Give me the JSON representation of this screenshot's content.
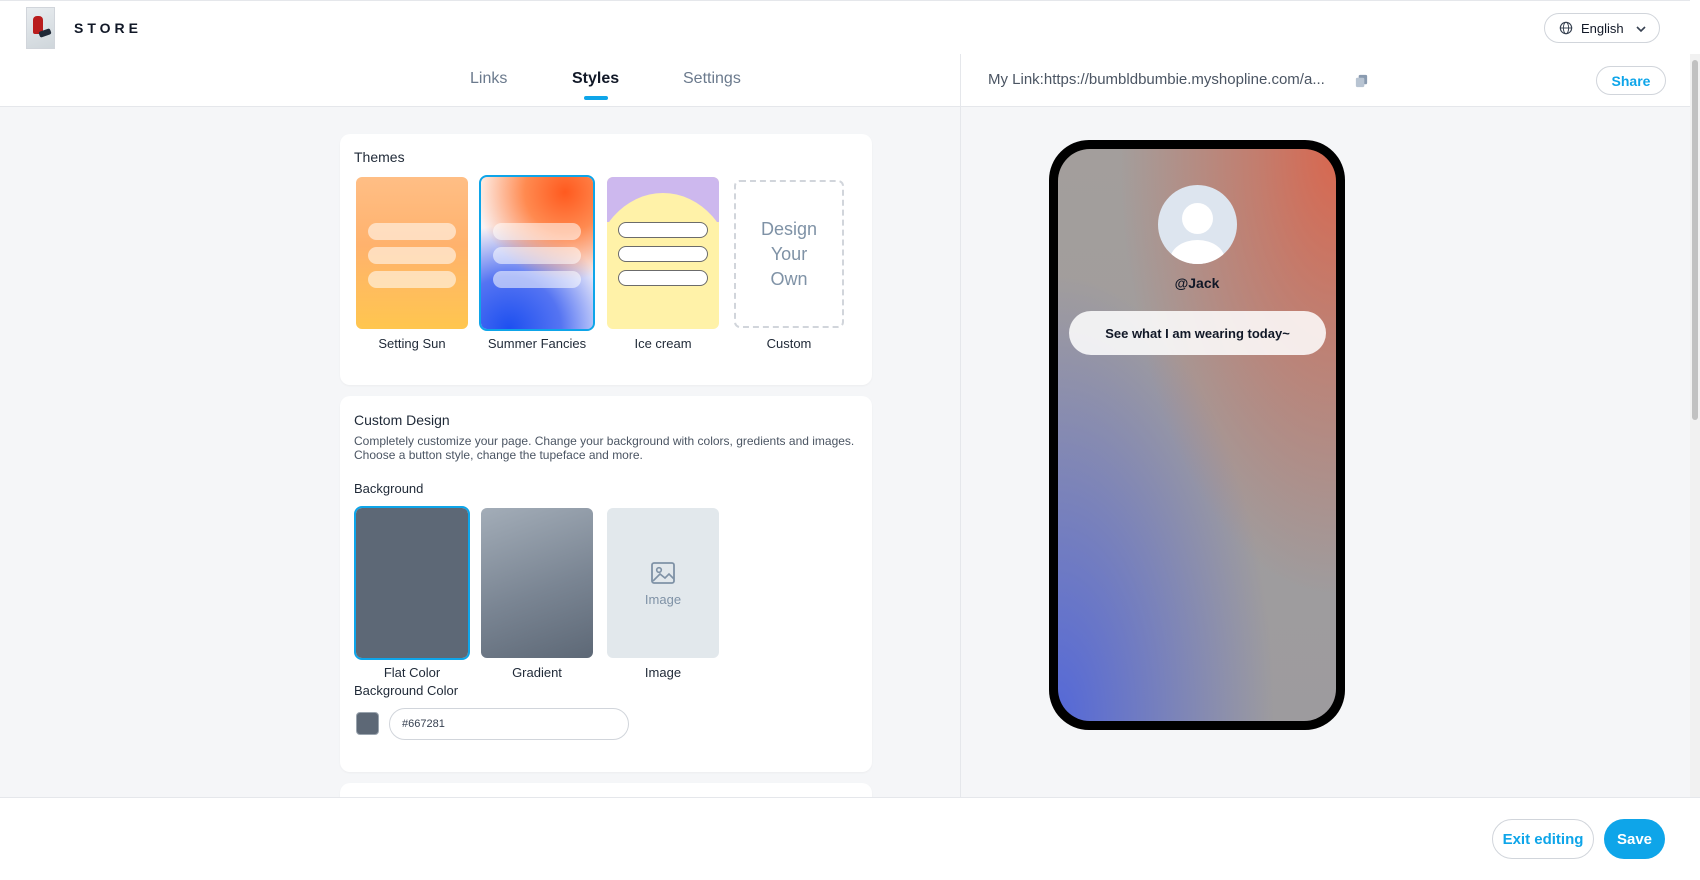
{
  "header": {
    "store_name": "STORE",
    "language": "English"
  },
  "tabs": [
    {
      "label": "Links"
    },
    {
      "label": "Styles"
    },
    {
      "label": "Settings"
    }
  ],
  "preview_bar": {
    "my_link": "My Link:https://bumbldbumbie.myshopline.com/a...",
    "share_label": "Share"
  },
  "themes": {
    "title": "Themes",
    "items": [
      {
        "label": "Setting Sun"
      },
      {
        "label": "Summer Fancies"
      },
      {
        "label": "Ice cream"
      },
      {
        "label": "Custom"
      }
    ],
    "custom_text": [
      "Design",
      "Your",
      "Own"
    ]
  },
  "custom_design": {
    "title": "Custom Design",
    "description": "Completely customize your page. Change your background with colors, gredients and images. Choose a button style, change the tupeface and more.",
    "background_label": "Background",
    "options": [
      {
        "label": "Flat Color"
      },
      {
        "label": "Gradient"
      },
      {
        "label": "Image"
      }
    ],
    "image_placeholder": "Image",
    "background_color_label": "Background Color",
    "background_color_value": "#667281"
  },
  "preview": {
    "handle": "@Jack",
    "link_text": "See what I am wearing today~"
  },
  "footer": {
    "exit_label": "Exit editing",
    "save_label": "Save"
  },
  "colors": {
    "accent": "#0ea5e9",
    "flat_color": "#5d6876"
  }
}
